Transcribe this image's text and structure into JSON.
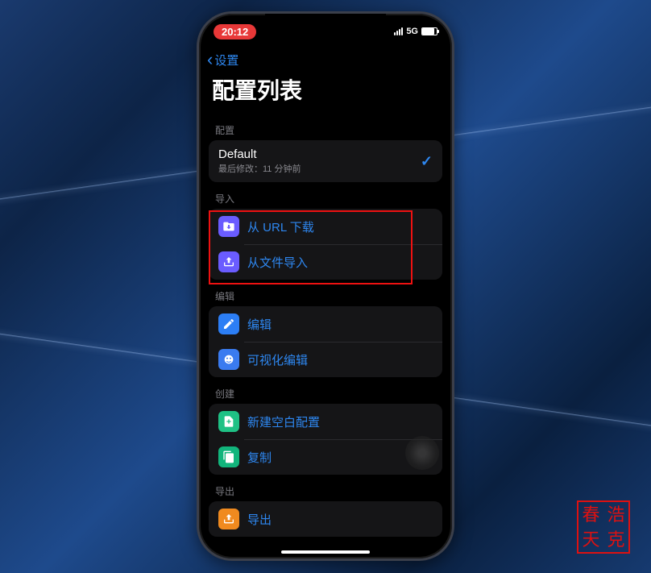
{
  "status": {
    "time": "20:12",
    "network": "5G"
  },
  "nav": {
    "back_label": "设置"
  },
  "page": {
    "title": "配置列表"
  },
  "config_section": {
    "header": "配置",
    "item": {
      "title": "Default",
      "subtitle": "最后修改：11 分钟前"
    }
  },
  "import_section": {
    "header": "导入",
    "url_label": "从 URL 下载",
    "file_label": "从文件导入"
  },
  "edit_section": {
    "header": "编辑",
    "edit_label": "编辑",
    "visual_label": "可视化编辑"
  },
  "create_section": {
    "header": "创建",
    "blank_label": "新建空白配置",
    "copy_label": "复制"
  },
  "export_section": {
    "header": "导出",
    "export_label": "导出"
  },
  "stamp": {
    "tl": "春",
    "tr": "浩",
    "bl": "天",
    "br": "克"
  },
  "colors": {
    "accent": "#2e87f0",
    "purple": "#6a5cff",
    "blue_edit": "#2c7ef5",
    "teal": "#1fc185",
    "green_copy": "#12b57c",
    "orange": "#f08a1f",
    "visual": "#3a7bf0"
  }
}
